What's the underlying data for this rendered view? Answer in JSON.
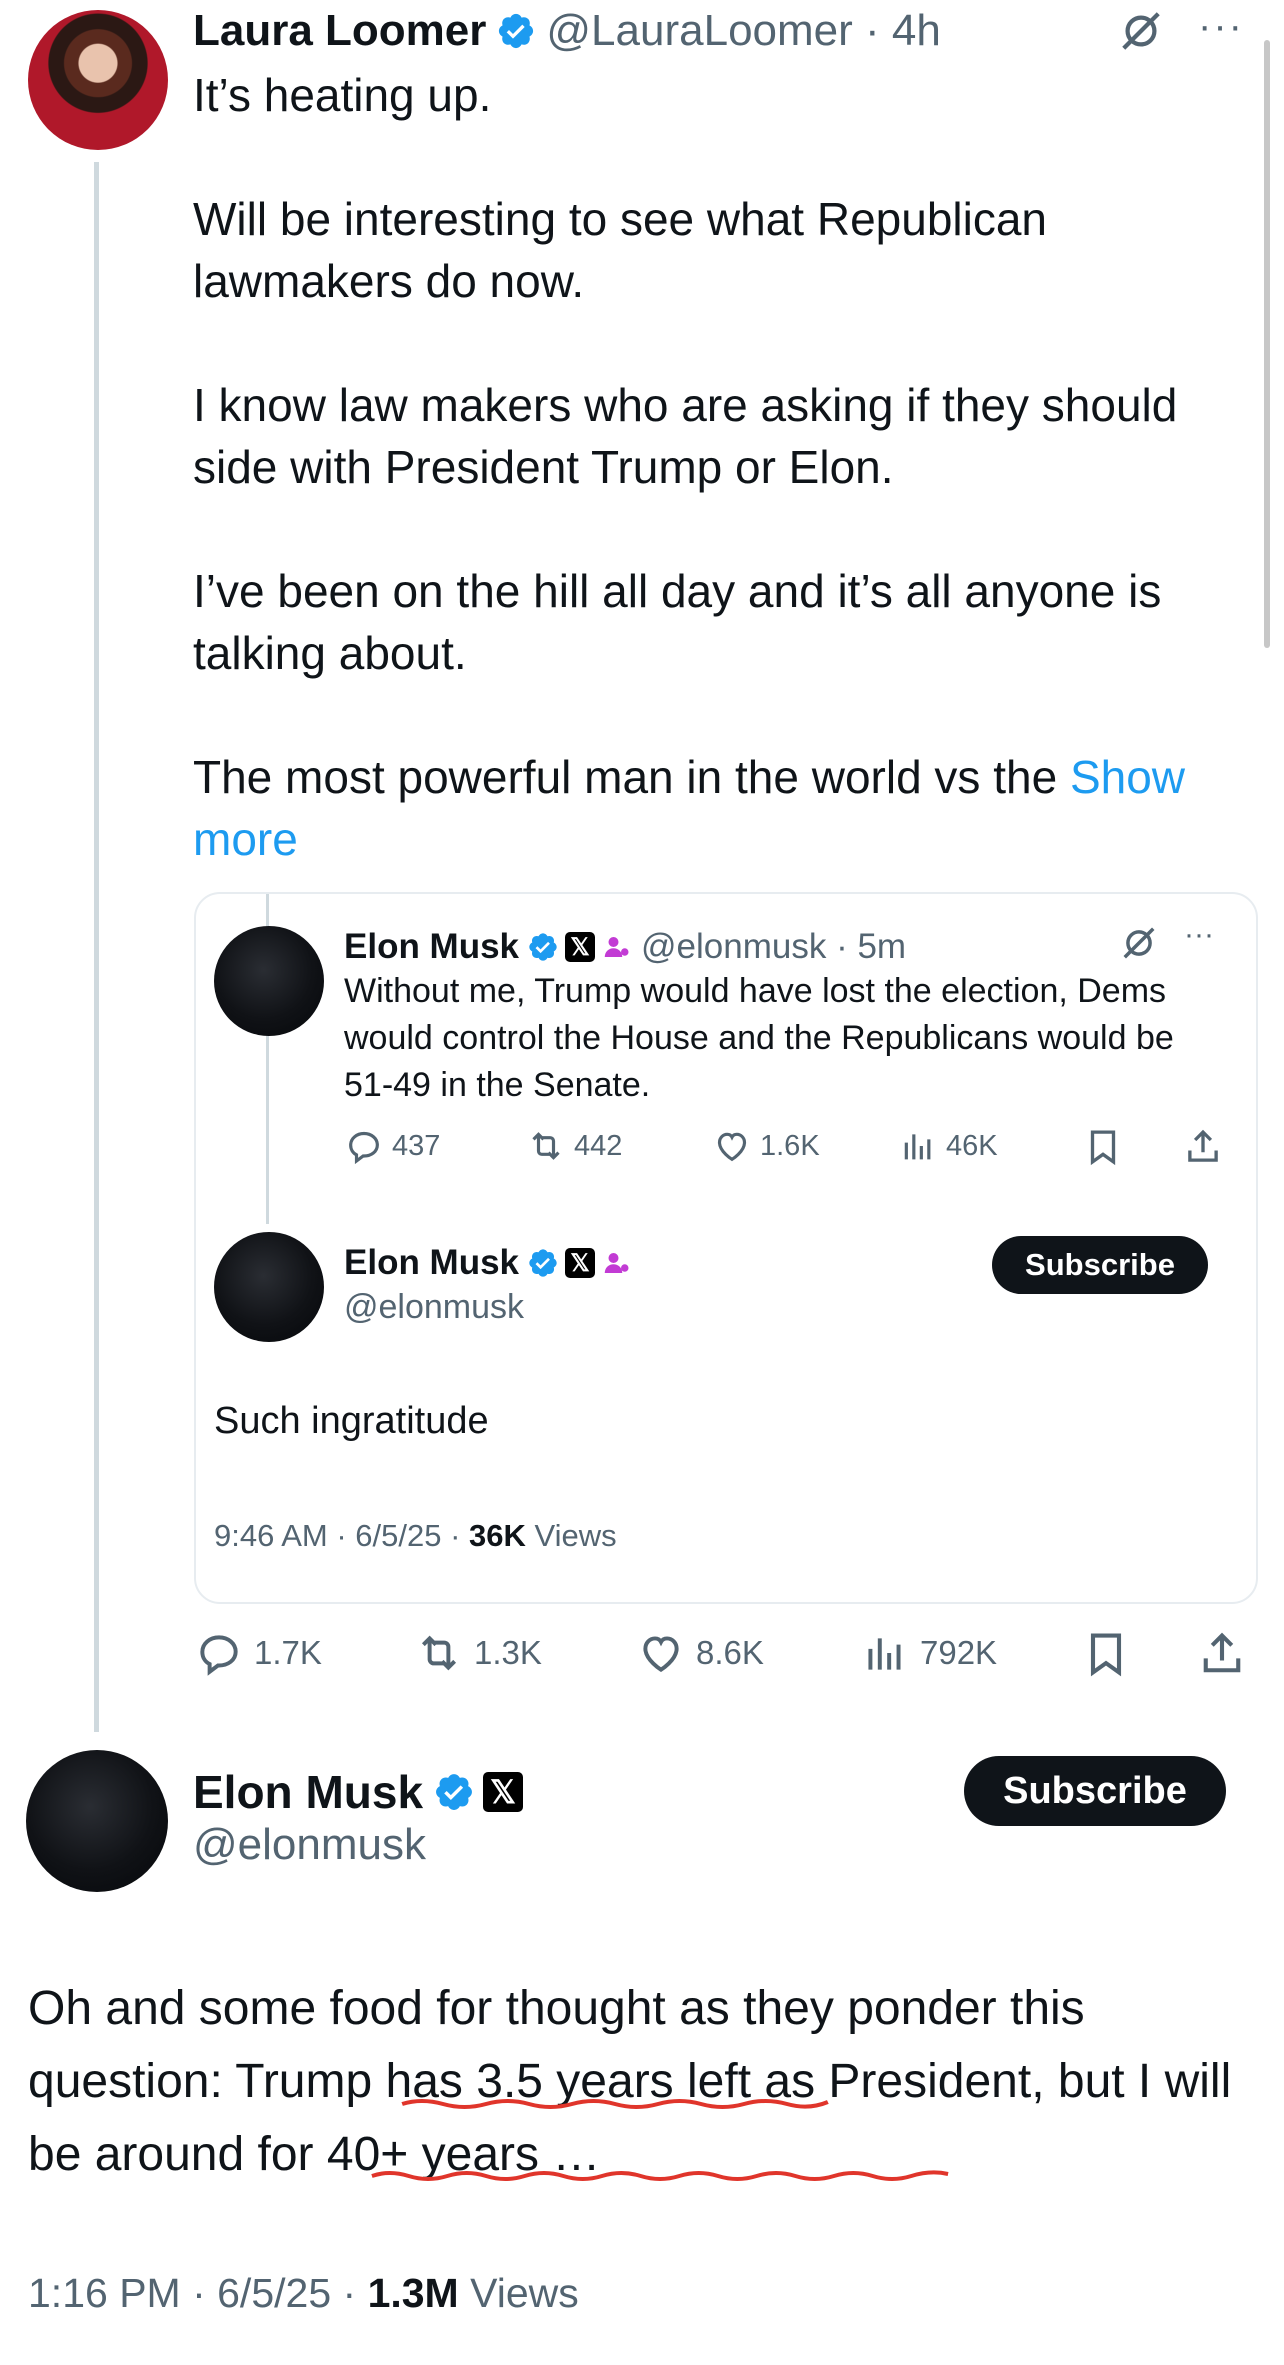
{
  "main_tweet": {
    "author_name": "Laura Loomer",
    "handle_time": "@LauraLoomer · 4h",
    "paragraphs": [
      "It’s heating up.",
      "Will be interesting to see what Republican lawmakers do now.",
      "I know law makers who are asking if they should side with President Trump or Elon.",
      "I’ve been on the hill all day and it’s all anyone is talking about."
    ],
    "last_line": "The most powerful man in the world vs the",
    "show_more": "Show more",
    "actions": {
      "replies": "1.7K",
      "reposts": "1.3K",
      "likes": "8.6K",
      "views": "792K"
    }
  },
  "quoted_thread": {
    "first": {
      "author_name": "Elon Musk",
      "handle_time": "@elonmusk · 5m",
      "text": "Without me, Trump would have lost the election, Dems would control the House and the Republicans would be 51-49 in the Senate.",
      "actions": {
        "replies": "437",
        "reposts": "442",
        "likes": "1.6K",
        "views": "46K"
      }
    },
    "second": {
      "author_name": "Elon Musk",
      "handle": "@elonmusk",
      "subscribe_label": "Subscribe",
      "text": "Such ingratitude",
      "time": "9:46 AM · 6/5/25 · ",
      "views_count": "36K",
      "views_label": " Views"
    }
  },
  "reply_tweet": {
    "author_name": "Elon Musk",
    "handle": "@elonmusk",
    "subscribe_label": "Subscribe",
    "text": "Oh and some food for thought as they ponder this question: Trump has 3.5 years left as President, but I will be around for 40+ years …",
    "time": "1:16 PM · 6/5/25 · ",
    "views_count": "1.3M",
    "views_label": " Views"
  },
  "colors": {
    "accent": "#1d9bf0",
    "text": "#0f1419",
    "secondary": "#536471",
    "underline": "#e0352b"
  }
}
